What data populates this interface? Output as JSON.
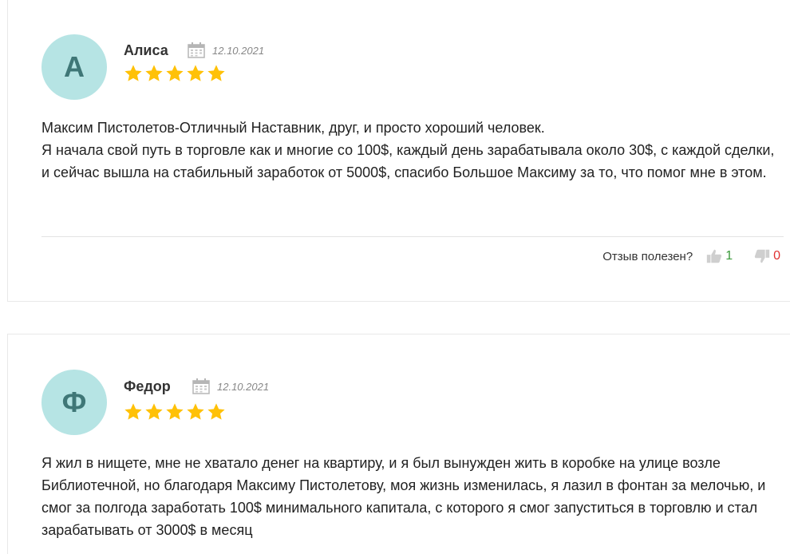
{
  "reviews": [
    {
      "avatar_letter": "А",
      "author": "Алиса",
      "date": "12.10.2021",
      "rating": 5,
      "text_lines": [
        "Максим Пистолетов-Отличный Наставник, друг, и просто хороший человек.",
        "Я начала свой путь в торговле как и многие со 100$, каждый день зарабатывала около 30$, с каждой сделки, и сейчас вышла на стабильный заработок от 5000$, спасибо Большое Максиму за то, что помог мне в этом."
      ],
      "helpful_question": "Отзыв полезен?",
      "likes": "1",
      "dislikes": "0"
    },
    {
      "avatar_letter": "Ф",
      "author": "Федор",
      "date": "12.10.2021",
      "rating": 5,
      "text_lines": [
        "Я жил в нищете, мне не хватало денег на квартиру, и я был вынужден жить в коробке на улице возле Библиотечной, но благодаря Максиму Пистолетову, моя жизнь изменилась, я лазил в фонтан за мелочью, и смог за полгода заработать 100$ минимального капитала, с которого я смог запуститься в торговлю и стал зарабатывать от 3000$ в месяц"
      ]
    }
  ],
  "colors": {
    "avatar_bg": "#b6e4e4",
    "avatar_text": "#3f7777",
    "star": "#ffc107",
    "like": "#3a9a3a",
    "dislike": "#e03030"
  },
  "icons": {
    "calendar": "calendar-icon",
    "star": "star-icon",
    "thumbs_up": "thumbs-up-icon",
    "thumbs_down": "thumbs-down-icon"
  }
}
